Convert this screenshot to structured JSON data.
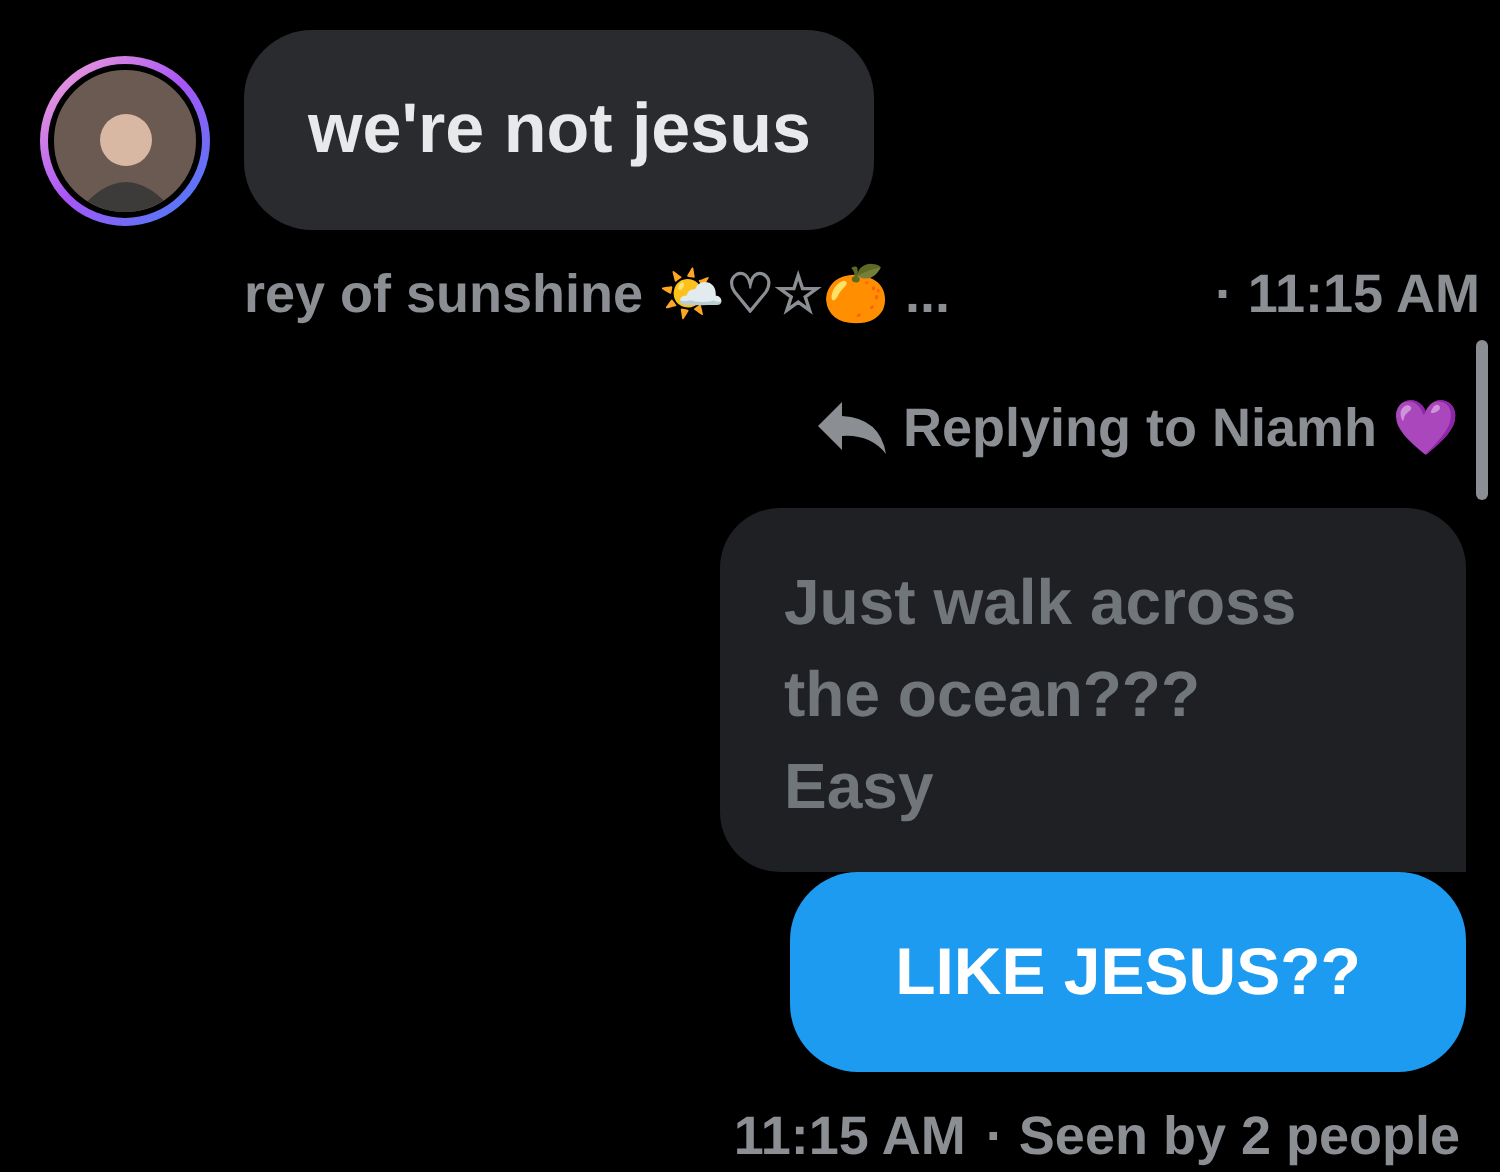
{
  "received": {
    "text": "we're not jesus",
    "sender": "rey of sunshine 🌤️♡☆🍊 ...",
    "time": "· 11:15 AM"
  },
  "reply": {
    "label": "Replying to Niamh 💜",
    "quoted_text": "Just walk across\nthe ocean???\nEasy"
  },
  "sent": {
    "text": "LIKE JESUS??",
    "time": "11:15 AM",
    "status": "· Seen by 2 people"
  }
}
